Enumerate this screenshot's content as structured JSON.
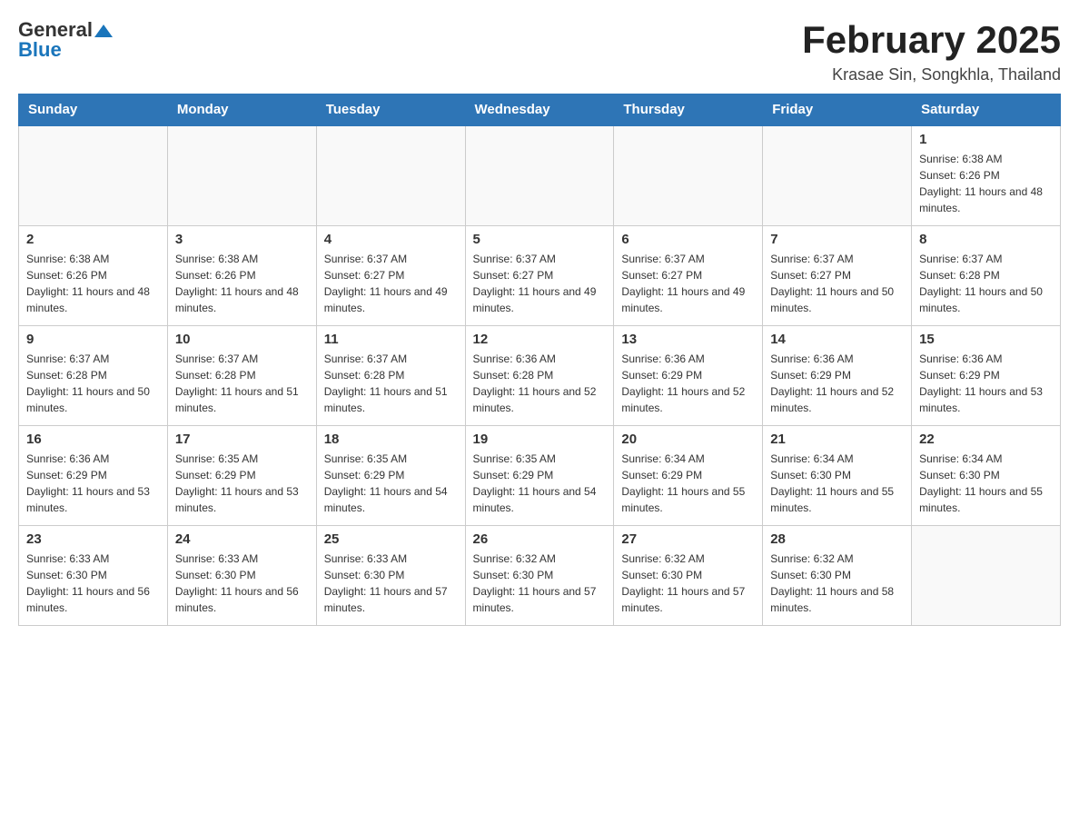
{
  "header": {
    "logo_general": "General",
    "logo_blue": "Blue",
    "month_title": "February 2025",
    "location": "Krasae Sin, Songkhla, Thailand"
  },
  "days_of_week": [
    "Sunday",
    "Monday",
    "Tuesday",
    "Wednesday",
    "Thursday",
    "Friday",
    "Saturday"
  ],
  "weeks": [
    [
      {
        "day": "",
        "sunrise": "",
        "sunset": "",
        "daylight": ""
      },
      {
        "day": "",
        "sunrise": "",
        "sunset": "",
        "daylight": ""
      },
      {
        "day": "",
        "sunrise": "",
        "sunset": "",
        "daylight": ""
      },
      {
        "day": "",
        "sunrise": "",
        "sunset": "",
        "daylight": ""
      },
      {
        "day": "",
        "sunrise": "",
        "sunset": "",
        "daylight": ""
      },
      {
        "day": "",
        "sunrise": "",
        "sunset": "",
        "daylight": ""
      },
      {
        "day": "1",
        "sunrise": "Sunrise: 6:38 AM",
        "sunset": "Sunset: 6:26 PM",
        "daylight": "Daylight: 11 hours and 48 minutes."
      }
    ],
    [
      {
        "day": "2",
        "sunrise": "Sunrise: 6:38 AM",
        "sunset": "Sunset: 6:26 PM",
        "daylight": "Daylight: 11 hours and 48 minutes."
      },
      {
        "day": "3",
        "sunrise": "Sunrise: 6:38 AM",
        "sunset": "Sunset: 6:26 PM",
        "daylight": "Daylight: 11 hours and 48 minutes."
      },
      {
        "day": "4",
        "sunrise": "Sunrise: 6:37 AM",
        "sunset": "Sunset: 6:27 PM",
        "daylight": "Daylight: 11 hours and 49 minutes."
      },
      {
        "day": "5",
        "sunrise": "Sunrise: 6:37 AM",
        "sunset": "Sunset: 6:27 PM",
        "daylight": "Daylight: 11 hours and 49 minutes."
      },
      {
        "day": "6",
        "sunrise": "Sunrise: 6:37 AM",
        "sunset": "Sunset: 6:27 PM",
        "daylight": "Daylight: 11 hours and 49 minutes."
      },
      {
        "day": "7",
        "sunrise": "Sunrise: 6:37 AM",
        "sunset": "Sunset: 6:27 PM",
        "daylight": "Daylight: 11 hours and 50 minutes."
      },
      {
        "day": "8",
        "sunrise": "Sunrise: 6:37 AM",
        "sunset": "Sunset: 6:28 PM",
        "daylight": "Daylight: 11 hours and 50 minutes."
      }
    ],
    [
      {
        "day": "9",
        "sunrise": "Sunrise: 6:37 AM",
        "sunset": "Sunset: 6:28 PM",
        "daylight": "Daylight: 11 hours and 50 minutes."
      },
      {
        "day": "10",
        "sunrise": "Sunrise: 6:37 AM",
        "sunset": "Sunset: 6:28 PM",
        "daylight": "Daylight: 11 hours and 51 minutes."
      },
      {
        "day": "11",
        "sunrise": "Sunrise: 6:37 AM",
        "sunset": "Sunset: 6:28 PM",
        "daylight": "Daylight: 11 hours and 51 minutes."
      },
      {
        "day": "12",
        "sunrise": "Sunrise: 6:36 AM",
        "sunset": "Sunset: 6:28 PM",
        "daylight": "Daylight: 11 hours and 52 minutes."
      },
      {
        "day": "13",
        "sunrise": "Sunrise: 6:36 AM",
        "sunset": "Sunset: 6:29 PM",
        "daylight": "Daylight: 11 hours and 52 minutes."
      },
      {
        "day": "14",
        "sunrise": "Sunrise: 6:36 AM",
        "sunset": "Sunset: 6:29 PM",
        "daylight": "Daylight: 11 hours and 52 minutes."
      },
      {
        "day": "15",
        "sunrise": "Sunrise: 6:36 AM",
        "sunset": "Sunset: 6:29 PM",
        "daylight": "Daylight: 11 hours and 53 minutes."
      }
    ],
    [
      {
        "day": "16",
        "sunrise": "Sunrise: 6:36 AM",
        "sunset": "Sunset: 6:29 PM",
        "daylight": "Daylight: 11 hours and 53 minutes."
      },
      {
        "day": "17",
        "sunrise": "Sunrise: 6:35 AM",
        "sunset": "Sunset: 6:29 PM",
        "daylight": "Daylight: 11 hours and 53 minutes."
      },
      {
        "day": "18",
        "sunrise": "Sunrise: 6:35 AM",
        "sunset": "Sunset: 6:29 PM",
        "daylight": "Daylight: 11 hours and 54 minutes."
      },
      {
        "day": "19",
        "sunrise": "Sunrise: 6:35 AM",
        "sunset": "Sunset: 6:29 PM",
        "daylight": "Daylight: 11 hours and 54 minutes."
      },
      {
        "day": "20",
        "sunrise": "Sunrise: 6:34 AM",
        "sunset": "Sunset: 6:29 PM",
        "daylight": "Daylight: 11 hours and 55 minutes."
      },
      {
        "day": "21",
        "sunrise": "Sunrise: 6:34 AM",
        "sunset": "Sunset: 6:30 PM",
        "daylight": "Daylight: 11 hours and 55 minutes."
      },
      {
        "day": "22",
        "sunrise": "Sunrise: 6:34 AM",
        "sunset": "Sunset: 6:30 PM",
        "daylight": "Daylight: 11 hours and 55 minutes."
      }
    ],
    [
      {
        "day": "23",
        "sunrise": "Sunrise: 6:33 AM",
        "sunset": "Sunset: 6:30 PM",
        "daylight": "Daylight: 11 hours and 56 minutes."
      },
      {
        "day": "24",
        "sunrise": "Sunrise: 6:33 AM",
        "sunset": "Sunset: 6:30 PM",
        "daylight": "Daylight: 11 hours and 56 minutes."
      },
      {
        "day": "25",
        "sunrise": "Sunrise: 6:33 AM",
        "sunset": "Sunset: 6:30 PM",
        "daylight": "Daylight: 11 hours and 57 minutes."
      },
      {
        "day": "26",
        "sunrise": "Sunrise: 6:32 AM",
        "sunset": "Sunset: 6:30 PM",
        "daylight": "Daylight: 11 hours and 57 minutes."
      },
      {
        "day": "27",
        "sunrise": "Sunrise: 6:32 AM",
        "sunset": "Sunset: 6:30 PM",
        "daylight": "Daylight: 11 hours and 57 minutes."
      },
      {
        "day": "28",
        "sunrise": "Sunrise: 6:32 AM",
        "sunset": "Sunset: 6:30 PM",
        "daylight": "Daylight: 11 hours and 58 minutes."
      },
      {
        "day": "",
        "sunrise": "",
        "sunset": "",
        "daylight": ""
      }
    ]
  ]
}
